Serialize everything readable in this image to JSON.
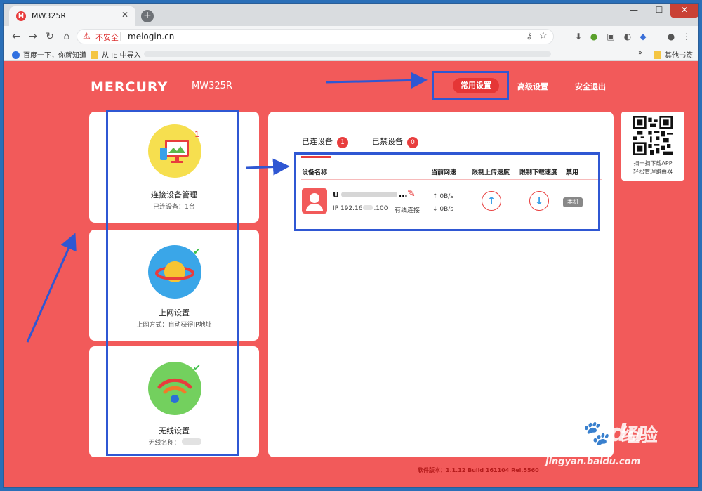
{
  "browser": {
    "tab_title": "MW325R",
    "tab_favicon_letter": "M",
    "address": {
      "warning": "不安全",
      "url": "melogin.cn"
    },
    "bookmarks": [
      {
        "label": "百度一下，你就知道"
      },
      {
        "label": "从 IE 中导入"
      }
    ],
    "bookmarks_more": "»",
    "other_bookmarks": "其他书签"
  },
  "header": {
    "logo": "MERCURY",
    "model": "MW325R",
    "nav": {
      "common": "常用设置",
      "advanced": "高级设置",
      "logout": "安全退出"
    }
  },
  "sidebar": {
    "cards": [
      {
        "title": "连接设备管理",
        "subtitle": "已连设备：1台",
        "badge": "1",
        "icon": "monitor-icon"
      },
      {
        "title": "上网设置",
        "subtitle": "上网方式：自动获得IP地址",
        "icon": "planet-icon"
      },
      {
        "title": "无线设置",
        "subtitle": "无线名称：",
        "icon": "wifi-icon"
      }
    ]
  },
  "main": {
    "tabs": [
      {
        "label": "已连设备",
        "count": "1"
      },
      {
        "label": "已禁设备",
        "count": "0"
      }
    ],
    "columns": [
      "设备名称",
      "当前网速",
      "限制上传速度",
      "限制下载速度",
      "禁用"
    ],
    "device": {
      "name_initial": "U",
      "name_suffix": "...",
      "ip": "IP 192.16",
      "ip_end": ".100",
      "connection": "有线连接",
      "up_speed": "↑ 0B/s",
      "down_speed": "↓ 0B/s",
      "local_tag": "本机"
    }
  },
  "qr": {
    "line1": "扫一扫下载APP",
    "line2": "轻松管理路由器"
  },
  "footer": {
    "version": "软件版本：1.1.12 Build 161104 Rel.5560"
  },
  "watermark": {
    "brand": "Bai",
    "brand2": "du",
    "cn": "经验",
    "url": "jingyan.baidu.com"
  },
  "colors": {
    "brand_red": "#f25a5a",
    "accent_red": "#e83d3d",
    "annotation_blue": "#2f57d3"
  }
}
